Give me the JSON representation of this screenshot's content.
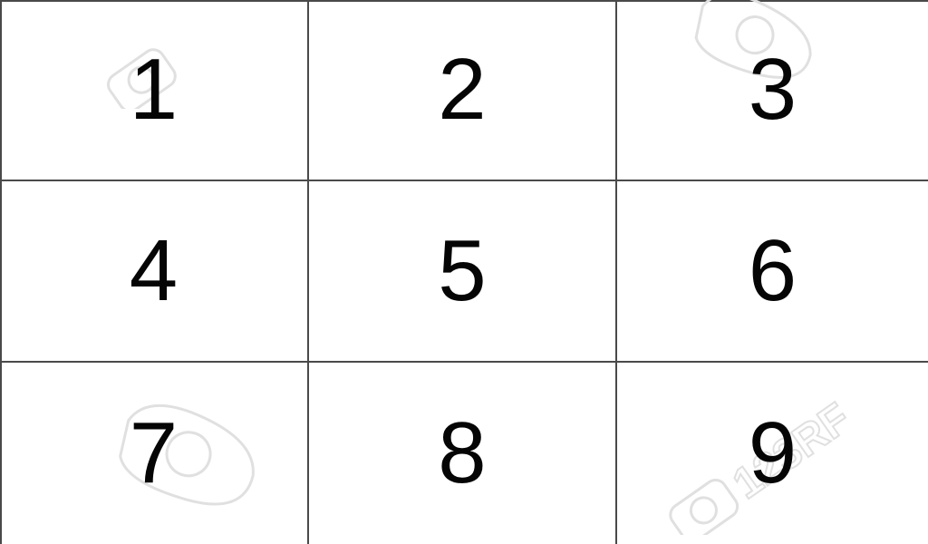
{
  "cells": [
    {
      "label": "1"
    },
    {
      "label": "2"
    },
    {
      "label": "3"
    },
    {
      "label": "4"
    },
    {
      "label": "5"
    },
    {
      "label": "6"
    },
    {
      "label": "7"
    },
    {
      "label": "8"
    },
    {
      "label": "9"
    }
  ],
  "watermark": {
    "text": "123RF",
    "color": "#dcdcdc"
  },
  "colors": {
    "grid_line": "#4a4a4a",
    "digit": "#050505",
    "background": "#ffffff"
  }
}
